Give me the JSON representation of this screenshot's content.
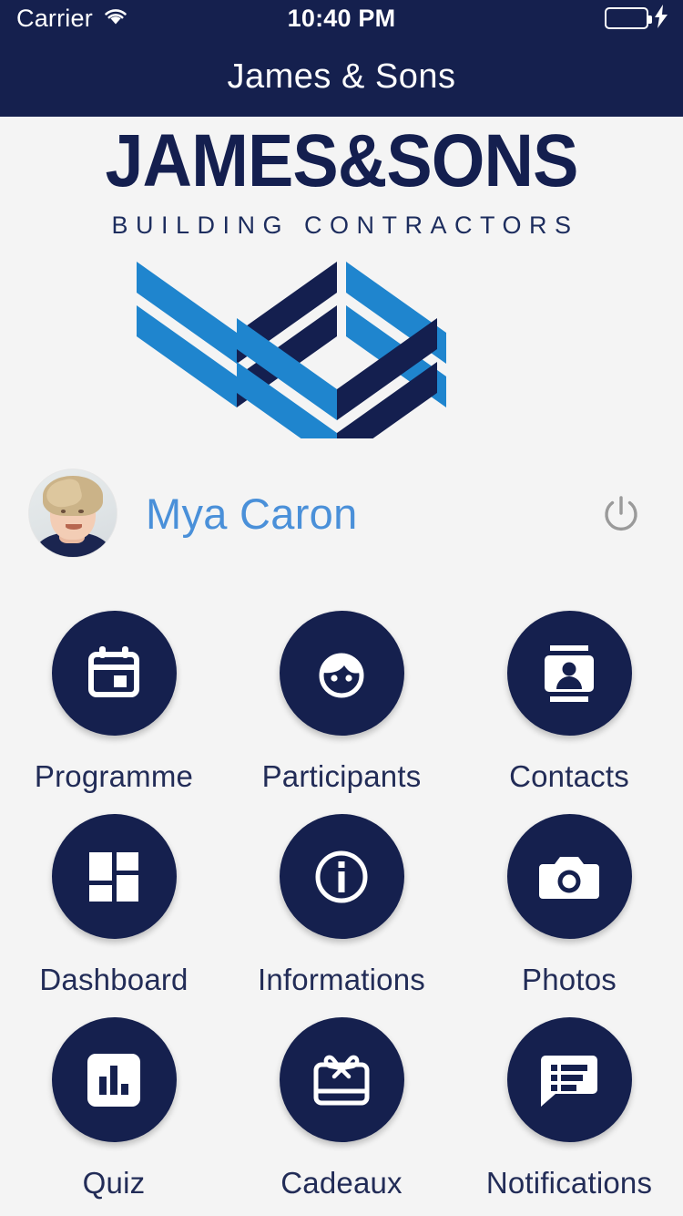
{
  "status_bar": {
    "carrier": "Carrier",
    "wifi_icon": "wifi-icon",
    "time": "10:40 PM",
    "battery_icon": "battery-full-icon",
    "charging_icon": "lightning-bolt-icon",
    "battery_color": "#4cd763"
  },
  "navbar": {
    "title": "James & Sons",
    "background": "#15204e"
  },
  "logo": {
    "wordmark": "JAMES&SONS",
    "tagline": "BUILDING CONTRACTORS",
    "mark_icon": "chevron-bars-logo-mark",
    "navy": "#141f4f",
    "blue": "#1f85ce"
  },
  "user": {
    "avatar_icon": "user-avatar-photo",
    "name": "Mya Caron",
    "name_color": "#4a90d9",
    "logout_icon": "power-icon"
  },
  "menu": {
    "tiles": [
      {
        "label": "Programme",
        "icon": "calendar-icon"
      },
      {
        "label": "Participants",
        "icon": "face-icon"
      },
      {
        "label": "Contacts",
        "icon": "contact-card-icon"
      },
      {
        "label": "Dashboard",
        "icon": "grid-tiles-icon"
      },
      {
        "label": "Informations",
        "icon": "info-circle-icon"
      },
      {
        "label": "Photos",
        "icon": "camera-icon"
      },
      {
        "label": "Quiz",
        "icon": "bar-chart-icon"
      },
      {
        "label": "Cadeaux",
        "icon": "gift-card-icon"
      },
      {
        "label": "Notifications",
        "icon": "message-list-icon"
      }
    ],
    "circle_color": "#15204e",
    "label_color": "#222c57"
  }
}
